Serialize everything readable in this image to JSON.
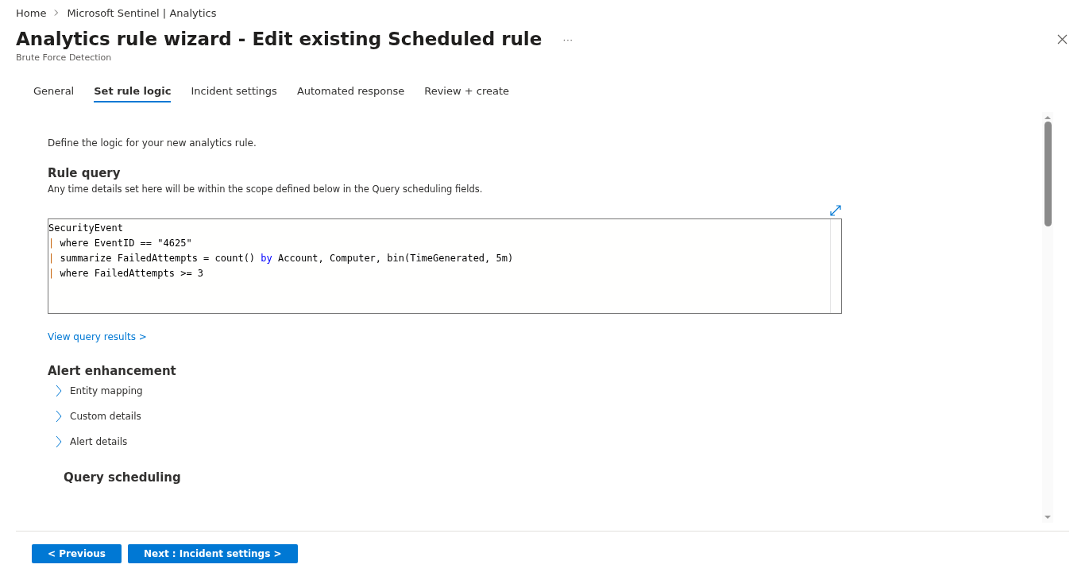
{
  "breadcrumb": [
    "Home",
    "Microsoft Sentinel | Analytics"
  ],
  "title": "Analytics rule wizard - Edit existing Scheduled rule",
  "more": "···",
  "subtitle": "Brute Force Detection",
  "tabs": [
    {
      "label": "General",
      "selected": false
    },
    {
      "label": "Set rule logic",
      "selected": true
    },
    {
      "label": "Incident settings",
      "selected": false
    },
    {
      "label": "Automated response",
      "selected": false
    },
    {
      "label": "Review + create",
      "selected": false
    }
  ],
  "intro": "Define the logic for your new analytics rule.",
  "rule_query": {
    "heading": "Rule query",
    "description": "Any time details set here will be within the scope defined below in the Query scheduling fields.",
    "lines": [
      [
        {
          "kind": "plain",
          "text": "SecurityEvent"
        }
      ],
      [
        {
          "kind": "pipe",
          "text": "|"
        },
        {
          "kind": "plain",
          "text": " where EventID == \"4625\""
        }
      ],
      [
        {
          "kind": "pipe",
          "text": "|"
        },
        {
          "kind": "plain",
          "text": " summarize FailedAttempts = count() "
        },
        {
          "kind": "keyword",
          "text": "by"
        },
        {
          "kind": "plain",
          "text": " Account, Computer, bin(TimeGenerated, 5m)"
        }
      ],
      [
        {
          "kind": "pipe",
          "text": "|"
        },
        {
          "kind": "plain",
          "text": " where FailedAttempts >= 3"
        }
      ]
    ]
  },
  "view_results": "View query results >",
  "alert_enhancement": {
    "heading": "Alert enhancement",
    "items": [
      {
        "label": "Entity mapping",
        "expanded": false
      },
      {
        "label": "Custom details",
        "expanded": false
      },
      {
        "label": "Alert details",
        "expanded": false
      }
    ]
  },
  "query_scheduling": "Query scheduling",
  "buttons": [
    "< Previous",
    "Next : Incident settings >"
  ]
}
